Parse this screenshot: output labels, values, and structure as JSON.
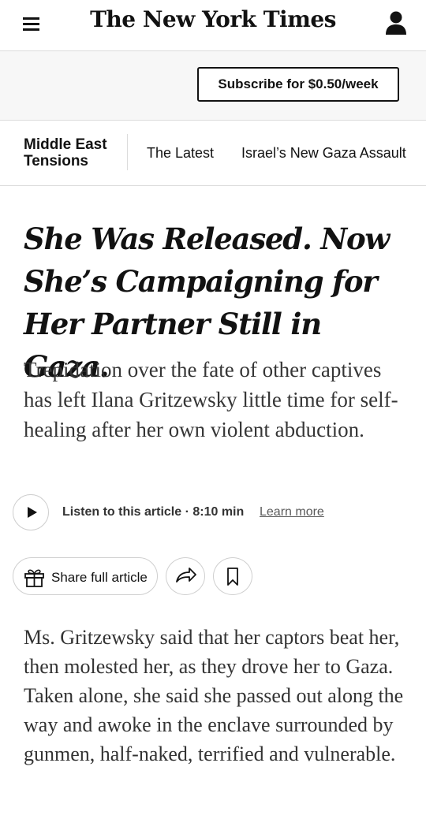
{
  "header": {
    "masthead": "The New York Times",
    "menu_icon": "hamburger-menu-icon",
    "account_icon": "user-account-icon"
  },
  "subscribe": {
    "label": "Subscribe for $0.50/week"
  },
  "section_nav": {
    "section": "Middle East Tensions",
    "links": [
      "The Latest",
      "Israel’s New Gaza Assault"
    ]
  },
  "article": {
    "headline": "She Was Released. Now She’s Campaigning for Her Partner Still in Gaza.",
    "summary": "Trepidation over the fate of other captives has left Ilana Gritzewsky little time for self-healing after her own violent abduction.",
    "listen_label": "Listen to this article · 8:10 min",
    "learn_more": "Learn more",
    "share_label": "Share full article",
    "body": "Ms. Gritzewsky said that her captors beat her, then molested her, as they drove her to Gaza. Taken alone, she said she passed out along the way and awoke in the enclave surrounded by gunmen, half-naked, terrified and vulnerable."
  },
  "icons": {
    "play": "play-icon",
    "gift": "gift-icon",
    "share": "share-arrow-icon",
    "save": "bookmark-icon"
  },
  "colors": {
    "text": "#121212",
    "band_background": "#f7f7f7",
    "divider": "#dcdcdc"
  }
}
